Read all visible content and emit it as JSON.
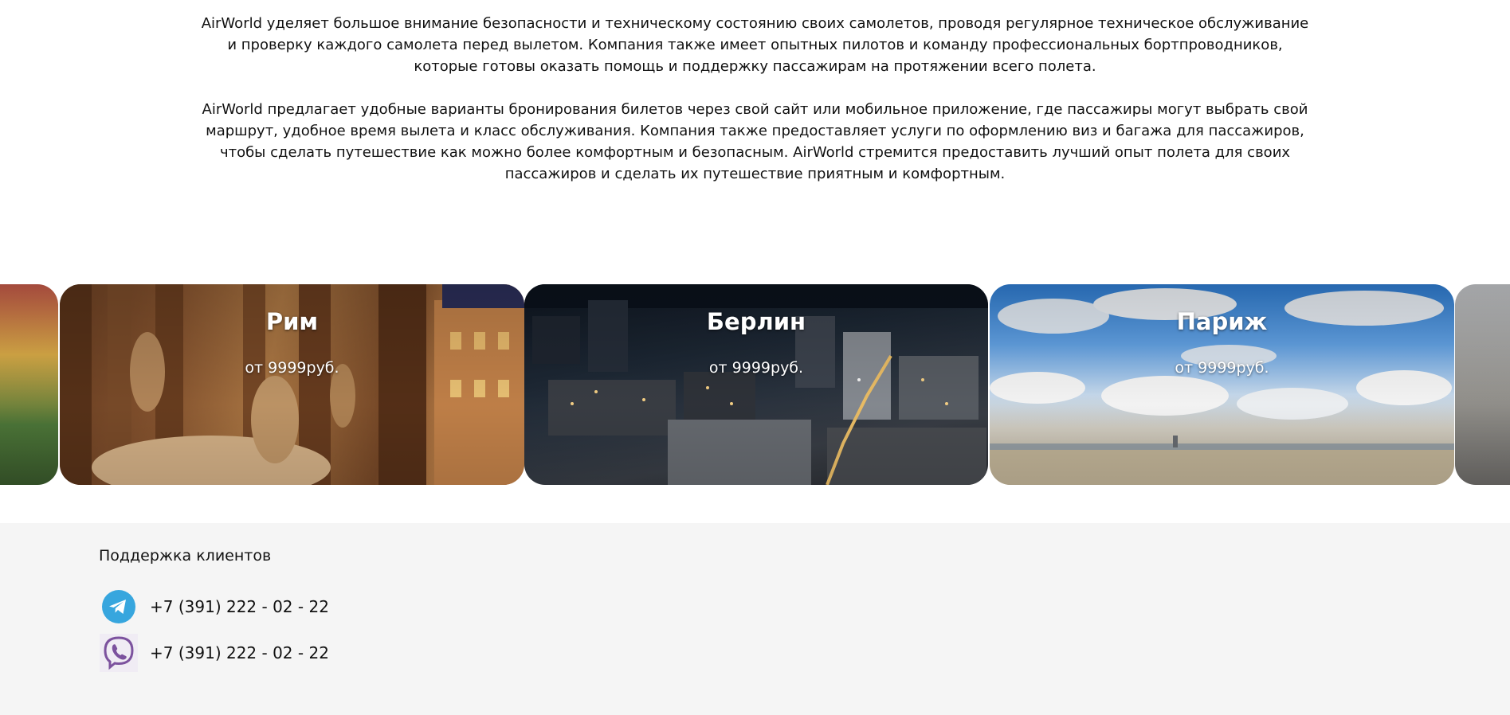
{
  "intro": {
    "paragraph1": "AirWorld уделяет большое внимание безопасности и техническому состоянию своих самолетов, проводя регулярное техническое обслуживание и проверку каждого самолета перед вылетом. Компания также имеет опытных пилотов и команду профессиональных бортпроводников, которые готовы оказать помощь и поддержку пассажирам на протяжении всего полета.",
    "paragraph2": "AirWorld предлагает удобные варианты бронирования билетов через свой сайт или мобильное приложение, где пассажиры могут выбрать свой маршрут, удобное время вылета и класс обслуживания. Компания также предоставляет услуги по оформлению виз и багажа для пассажиров, чтобы сделать путешествие как можно более комфортным и безопасным. AirWorld стремится предоставить лучший опыт полета для своих пассажиров и сделать их путешествие приятным и комфортным."
  },
  "destinations": [
    {
      "city": "Рим",
      "price": "от 9999руб."
    },
    {
      "city": "Берлин",
      "price": "от 9999руб."
    },
    {
      "city": "Париж",
      "price": "от 9999руб."
    }
  ],
  "footer": {
    "support_title": "Поддержка клиентов",
    "contacts": [
      {
        "icon": "telegram-icon",
        "phone": "+7 (391) 222 - 02 - 22"
      },
      {
        "icon": "viber-icon",
        "phone": "+7 (391) 222 - 02 - 22"
      }
    ]
  },
  "colors": {
    "footer_bg": "#f5f5f5",
    "telegram": "#37a6de",
    "viber": "#7c529e"
  }
}
